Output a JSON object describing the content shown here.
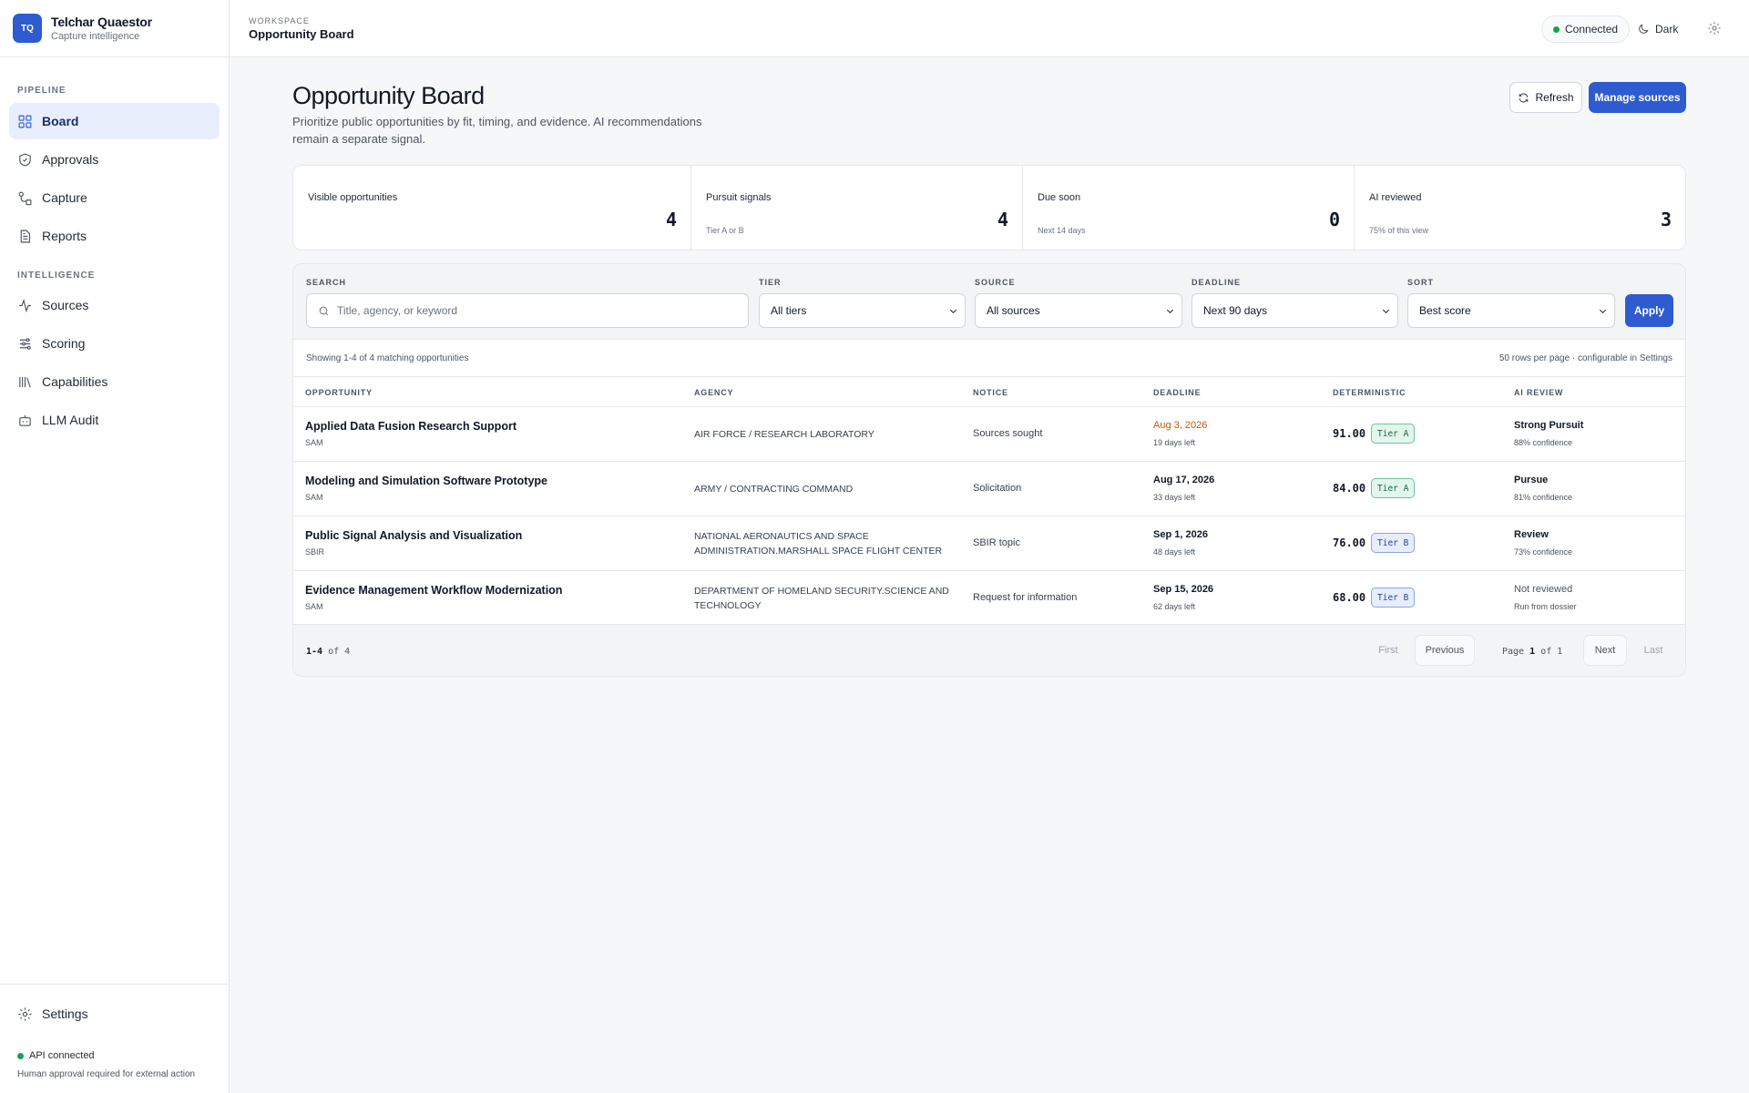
{
  "brand": {
    "logo": "TQ",
    "name": "Telchar Quaestor",
    "subtitle": "Capture intelligence"
  },
  "sidebar": {
    "sections": [
      {
        "label": "PIPELINE"
      },
      {
        "label": "INTELLIGENCE"
      }
    ],
    "items": [
      {
        "label": "Board",
        "icon": "grid-icon",
        "active": true
      },
      {
        "label": "Approvals",
        "icon": "shield-check-icon"
      },
      {
        "label": "Capture",
        "icon": "workflow-icon"
      },
      {
        "label": "Reports",
        "icon": "document-icon"
      },
      {
        "label": "Sources",
        "icon": "activity-icon"
      },
      {
        "label": "Scoring",
        "icon": "sliders-icon"
      },
      {
        "label": "Capabilities",
        "icon": "library-icon"
      },
      {
        "label": "LLM Audit",
        "icon": "bot-icon"
      }
    ],
    "settings_label": "Settings",
    "api_status": "API connected",
    "api_note": "Human approval required for external action"
  },
  "topbar": {
    "workspace_label": "WORKSPACE",
    "workspace_title": "Opportunity Board",
    "connection": "Connected",
    "theme_toggle": "Dark"
  },
  "page": {
    "title": "Opportunity Board",
    "description": "Prioritize public opportunities by fit, timing, and evidence. AI recommendations remain a separate signal.",
    "refresh_label": "Refresh",
    "manage_label": "Manage sources"
  },
  "stats": [
    {
      "label": "Visible opportunities",
      "sub": "",
      "value": "4"
    },
    {
      "label": "Pursuit signals",
      "sub": "Tier A or B",
      "value": "4"
    },
    {
      "label": "Due soon",
      "sub": "Next 14 days",
      "value": "0"
    },
    {
      "label": "AI reviewed",
      "sub": "75% of this view",
      "value": "3"
    }
  ],
  "filters": {
    "search": {
      "label": "SEARCH",
      "placeholder": "Title, agency, or keyword"
    },
    "tier": {
      "label": "TIER",
      "value": "All tiers"
    },
    "source": {
      "label": "SOURCE",
      "value": "All sources"
    },
    "deadline": {
      "label": "DEADLINE",
      "value": "Next 90 days"
    },
    "sort": {
      "label": "SORT",
      "value": "Best score"
    },
    "apply_label": "Apply"
  },
  "table": {
    "showing": "Showing 1-4 of 4 matching opportunities",
    "rows_per_page": "50 rows per page · configurable in Settings",
    "columns": [
      "OPPORTUNITY",
      "AGENCY",
      "NOTICE",
      "DEADLINE",
      "DETERMINISTIC",
      "AI REVIEW"
    ],
    "rows": [
      {
        "title": "Applied Data Fusion Research Support",
        "source": "SAM",
        "agency": "AIR FORCE / RESEARCH LABORATORY",
        "notice": "Sources sought",
        "deadline": "Aug 3, 2026",
        "days_left": "19 days left",
        "score": "91.00",
        "tier": "Tier A",
        "recommendation": "Strong Pursuit",
        "confidence": "88% confidence"
      },
      {
        "title": "Modeling and Simulation Software Prototype",
        "source": "SAM",
        "agency": "ARMY / CONTRACTING COMMAND",
        "notice": "Solicitation",
        "deadline": "Aug 17, 2026",
        "days_left": "33 days left",
        "score": "84.00",
        "tier": "Tier A",
        "recommendation": "Pursue",
        "confidence": "81% confidence"
      },
      {
        "title": "Public Signal Analysis and Visualization",
        "source": "SBIR",
        "agency": "NATIONAL AERONAUTICS AND SPACE ADMINISTRATION.MARSHALL SPACE FLIGHT CENTER",
        "notice": "SBIR topic",
        "deadline": "Sep 1, 2026",
        "days_left": "48 days left",
        "score": "76.00",
        "tier": "Tier B",
        "recommendation": "Review",
        "confidence": "73% confidence"
      },
      {
        "title": "Evidence Management Workflow Modernization",
        "source": "SAM",
        "agency": "DEPARTMENT OF HOMELAND SECURITY.SCIENCE AND TECHNOLOGY",
        "notice": "Request for information",
        "deadline": "Sep 15, 2026",
        "days_left": "62 days left",
        "score": "68.00",
        "tier": "Tier B",
        "recommendation": "Not reviewed",
        "confidence": "Run from dossier"
      }
    ]
  },
  "pager": {
    "range": "1-4",
    "of": "of",
    "total": "4",
    "first": "First",
    "previous": "Previous",
    "page_label": "Page",
    "page": "1",
    "pages": "1",
    "next": "Next",
    "last": "Last"
  },
  "colors": {
    "accent": "#2f5bd1",
    "status_ok": "#16a34a",
    "warning": "#c2570c"
  }
}
